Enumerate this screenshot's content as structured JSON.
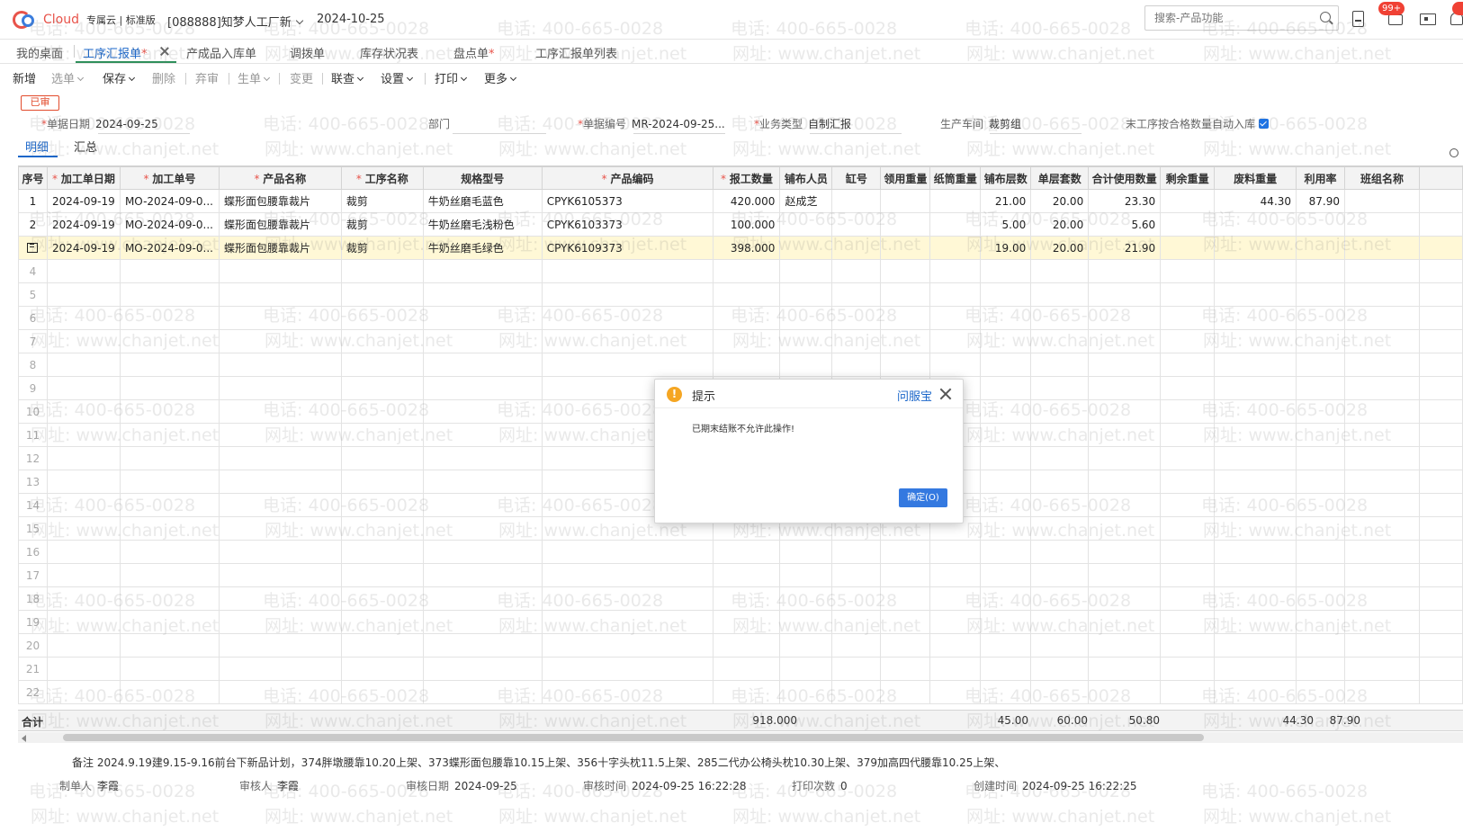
{
  "header": {
    "logo_text": "Cloud",
    "edition": "专属云 | 标准版",
    "company": "[088888]知梦人工厂新",
    "date": "2024-10-25",
    "search_placeholder": "搜索-产品功能",
    "badge": "99+"
  },
  "tabs": [
    {
      "label": "我的桌面",
      "required": ""
    },
    {
      "label": "工序汇报单",
      "required": "*",
      "active": true
    },
    {
      "label": "产成品入库单",
      "required": ""
    },
    {
      "label": "调拨单",
      "required": ""
    },
    {
      "label": "库存状况表",
      "required": ""
    },
    {
      "label": "盘点单",
      "required": "*"
    },
    {
      "label": "工序汇报单列表",
      "required": ""
    }
  ],
  "toolbar": [
    {
      "label": "新增",
      "dropdown": false,
      "disabled": false
    },
    {
      "label": "选单",
      "dropdown": true,
      "disabled": true
    },
    {
      "label": "保存",
      "dropdown": true,
      "disabled": false
    },
    {
      "label": "删除",
      "dropdown": false,
      "disabled": true
    },
    {
      "label": "弃审",
      "dropdown": false,
      "disabled": true
    },
    {
      "label": "生单",
      "dropdown": true,
      "disabled": true
    },
    {
      "label": "变更",
      "dropdown": false,
      "disabled": true
    },
    {
      "label": "联查",
      "dropdown": true,
      "disabled": false
    },
    {
      "label": "设置",
      "dropdown": true,
      "disabled": false
    },
    {
      "label": "打印",
      "dropdown": true,
      "disabled": false
    },
    {
      "label": "更多",
      "dropdown": true,
      "disabled": false
    }
  ],
  "status_stamp": "已审",
  "form": {
    "doc_date_label": "单据日期",
    "doc_date": "2024-09-25",
    "dept_label": "部门",
    "doc_no_label": "单据编号",
    "doc_no": "MR-2024-09-25...",
    "biz_type_label": "业务类型",
    "biz_type": "自制汇报",
    "workshop_label": "生产车间",
    "workshop": "裁剪组",
    "auto_stock_label": "末工序按合格数量自动入库",
    "auto_stock_checked": true
  },
  "subtabs": [
    "明细",
    "汇总"
  ],
  "columns": [
    {
      "label": "序号",
      "required": false
    },
    {
      "label": "加工单日期",
      "required": true
    },
    {
      "label": "加工单号",
      "required": true
    },
    {
      "label": "产品名称",
      "required": true
    },
    {
      "label": "工序名称",
      "required": true
    },
    {
      "label": "规格型号",
      "required": false
    },
    {
      "label": "产品编码",
      "required": true
    },
    {
      "label": "报工数量",
      "required": true
    },
    {
      "label": "铺布人员",
      "required": false
    },
    {
      "label": "缸号",
      "required": false
    },
    {
      "label": "领用重量",
      "required": false
    },
    {
      "label": "纸筒重量",
      "required": false
    },
    {
      "label": "铺布层数",
      "required": false
    },
    {
      "label": "单层套数",
      "required": false
    },
    {
      "label": "合计使用数量",
      "required": false
    },
    {
      "label": "剩余重量",
      "required": false
    },
    {
      "label": "废料重量",
      "required": false
    },
    {
      "label": "利用率",
      "required": false
    },
    {
      "label": "班组名称",
      "required": false
    },
    {
      "label": "",
      "required": false
    }
  ],
  "rows": [
    [
      "1",
      "2024-09-19",
      "MO-2024-09-0...",
      "蝶形面包腰靠裁片",
      "裁剪",
      "牛奶丝磨毛蓝色",
      "CPYK6105373",
      "420.000",
      "赵成芝",
      "",
      "",
      "",
      "21.00",
      "20.00",
      "23.30",
      "",
      "44.30",
      "87.90",
      "",
      ""
    ],
    [
      "2",
      "2024-09-19",
      "MO-2024-09-0...",
      "蝶形面包腰靠裁片",
      "裁剪",
      "牛奶丝磨毛浅粉色",
      "CPYK6103373",
      "100.000",
      "",
      "",
      "",
      "",
      "5.00",
      "20.00",
      "5.60",
      "",
      "",
      "",
      "",
      ""
    ],
    [
      "",
      "2024-09-19",
      "MO-2024-09-0...",
      "蝶形面包腰靠裁片",
      "裁剪",
      "牛奶丝磨毛绿色",
      "CPYK6109373",
      "398.000",
      "",
      "",
      "",
      "",
      "19.00",
      "20.00",
      "21.90",
      "",
      "",
      "",
      "",
      ""
    ]
  ],
  "empty_row_numbers": [
    "4",
    "5",
    "6",
    "7",
    "8",
    "9",
    "10",
    "11",
    "12",
    "13",
    "14",
    "15",
    "16",
    "17",
    "18",
    "19",
    "20",
    "21",
    "22"
  ],
  "totals": {
    "label": "合计",
    "qty": "918.000",
    "layers": "45.00",
    "sets": "60.00",
    "used": "50.80",
    "waste": "44.30",
    "rate": "87.90"
  },
  "remark": {
    "label": "备注",
    "text": "2024.9.19建9.15-9.16前台下新品计划，374胖墩腰靠10.20上架、373蝶形面包腰靠10.15上架、356十字头枕11.5上架、285二代办公椅头枕10.30上架、379加高四代腰靠10.25上架、"
  },
  "footer": [
    {
      "label": "制单人",
      "value": "李霞"
    },
    {
      "label": "审核人",
      "value": "李霞"
    },
    {
      "label": "审核日期",
      "value": "2024-09-25"
    },
    {
      "label": "审核时间",
      "value": "2024-09-25 16:22:28"
    },
    {
      "label": "打印次数",
      "value": "0"
    },
    {
      "label": "创建时间",
      "value": "2024-09-25 16:22:25"
    }
  ],
  "dialog": {
    "title": "提示",
    "help": "问服宝",
    "message": "已期末结账不允许此操作!",
    "ok": "确定(O)"
  },
  "watermark": {
    "phone": "电话: 400-665-0028",
    "site": "网址: www.chanjet.net"
  }
}
